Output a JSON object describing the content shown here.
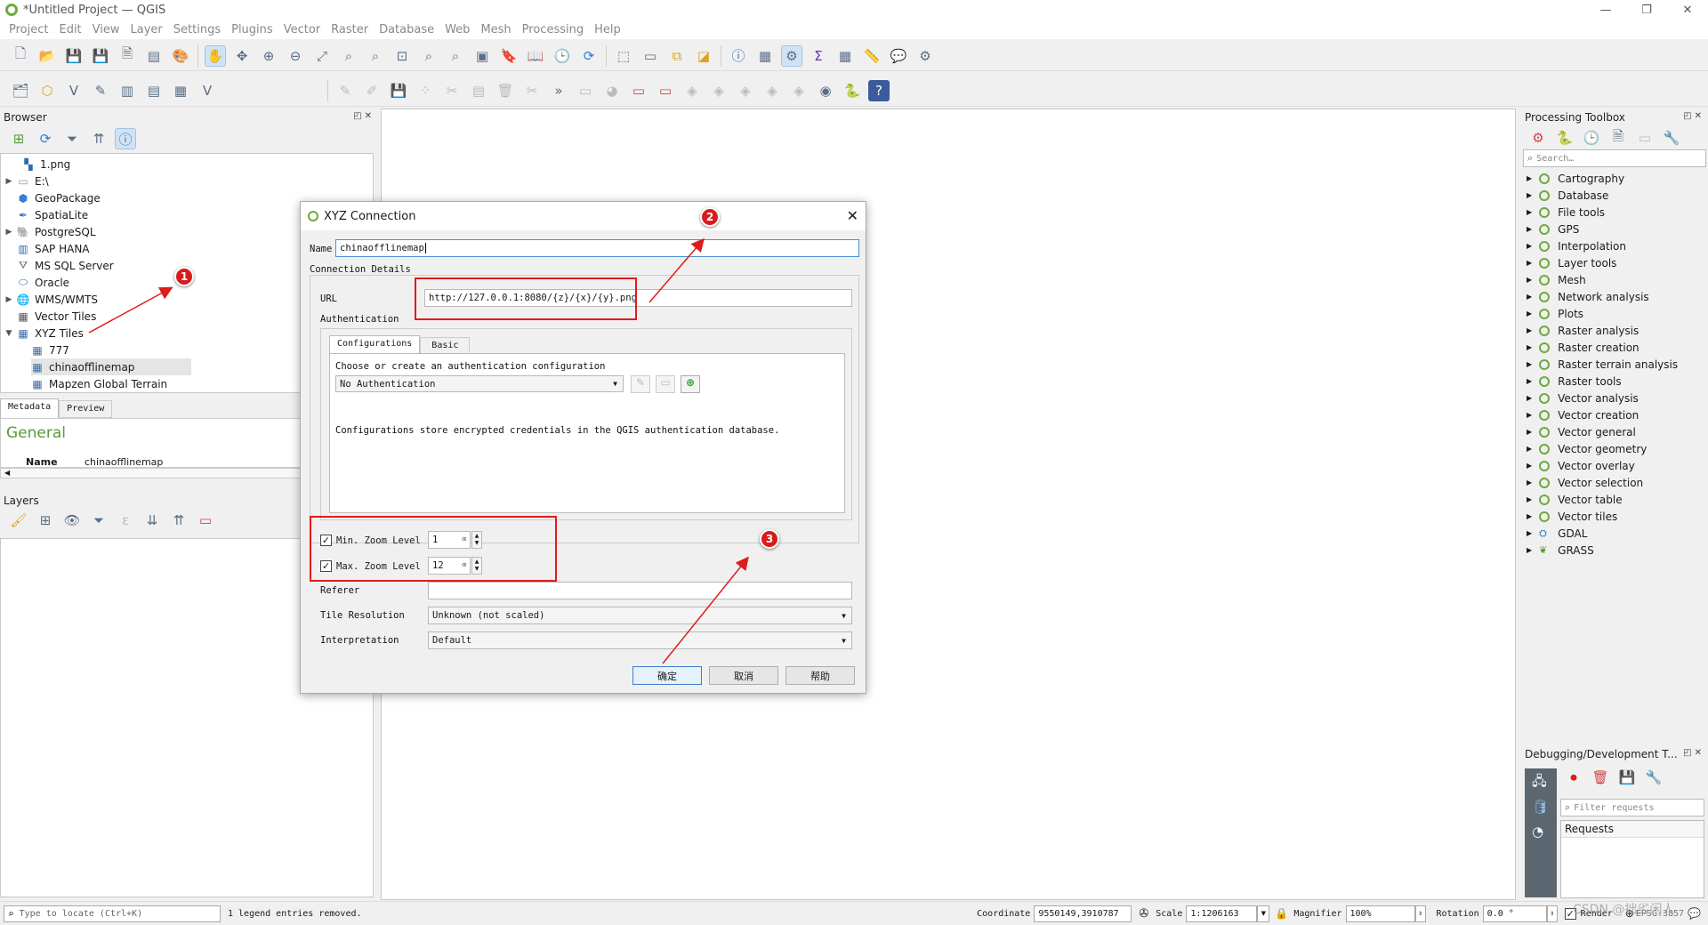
{
  "window": {
    "title": "*Untitled Project — QGIS"
  },
  "menu": [
    "Project",
    "Edit",
    "View",
    "Layer",
    "Settings",
    "Plugins",
    "Vector",
    "Raster",
    "Database",
    "Web",
    "Mesh",
    "Processing",
    "Help"
  ],
  "browser": {
    "title": "Browser",
    "items": [
      {
        "label": "1.png"
      },
      {
        "label": "E:\\"
      },
      {
        "label": "GeoPackage"
      },
      {
        "label": "SpatiaLite"
      },
      {
        "label": "PostgreSQL"
      },
      {
        "label": "SAP HANA"
      },
      {
        "label": "MS SQL Server"
      },
      {
        "label": "Oracle"
      },
      {
        "label": "WMS/WMTS"
      },
      {
        "label": "Vector Tiles"
      },
      {
        "label": "XYZ Tiles"
      },
      {
        "label": "777"
      },
      {
        "label": "chinaofflinemap"
      },
      {
        "label": "Mapzen Global Terrain"
      }
    ]
  },
  "metadata": {
    "tabs": [
      "Metadata",
      "Preview"
    ],
    "heading": "General",
    "name_label": "Name",
    "name_value": "chinaofflinemap"
  },
  "layers": {
    "title": "Layers"
  },
  "processing": {
    "title": "Processing Toolbox",
    "search_placeholder": "Search…",
    "items": [
      "Cartography",
      "Database",
      "File tools",
      "GPS",
      "Interpolation",
      "Layer tools",
      "Mesh",
      "Network analysis",
      "Plots",
      "Raster analysis",
      "Raster creation",
      "Raster terrain analysis",
      "Raster tools",
      "Vector analysis",
      "Vector creation",
      "Vector general",
      "Vector geometry",
      "Vector overlay",
      "Vector selection",
      "Vector table",
      "Vector tiles",
      "GDAL",
      "GRASS"
    ]
  },
  "debug": {
    "title": "Debugging/Development T...",
    "filter_placeholder": "Filter requests",
    "requests_label": "Requests"
  },
  "dialog": {
    "title": "XYZ Connection",
    "name_label": "Name",
    "name_value": "chinaofflinemap",
    "connection_details": "Connection Details",
    "url_label": "URL",
    "url_value": "http://127.0.0.1:8080/{z}/{x}/{y}.png",
    "auth_label": "Authentication",
    "tab_configurations": "Configurations",
    "tab_basic": "Basic",
    "choose_text": "Choose or create an authentication configuration",
    "auth_select": "No Authentication",
    "auth_note": "Configurations store encrypted credentials in the QGIS authentication database.",
    "min_zoom_label": "Min. Zoom Level",
    "min_zoom_value": "1",
    "max_zoom_label": "Max. Zoom Level",
    "max_zoom_value": "12",
    "referer_label": "Referer",
    "tile_resolution_label": "Tile Resolution",
    "tile_resolution_value": "Unknown (not scaled)",
    "interpretation_label": "Interpretation",
    "interpretation_value": "Default",
    "ok": "确定",
    "cancel": "取消",
    "help": "帮助"
  },
  "markers": [
    "1",
    "2",
    "3"
  ],
  "status": {
    "locate_placeholder": "Type to locate (Ctrl+K)",
    "message": "1 legend entries removed.",
    "coordinate_label": "Coordinate",
    "coordinate_value": "9550149,3910787",
    "scale_label": "Scale",
    "scale_value": "1:1206163",
    "magnifier_label": "Magnifier",
    "magnifier_value": "100%",
    "rotation_label": "Rotation",
    "rotation_value": "0.0 °",
    "render_label": "Render",
    "crs": "EPSG:3857",
    "watermark": "CSDN @拙劣闲人"
  },
  "colors": {
    "accent": "#6cab3c",
    "annotation": "#e01b1b"
  }
}
